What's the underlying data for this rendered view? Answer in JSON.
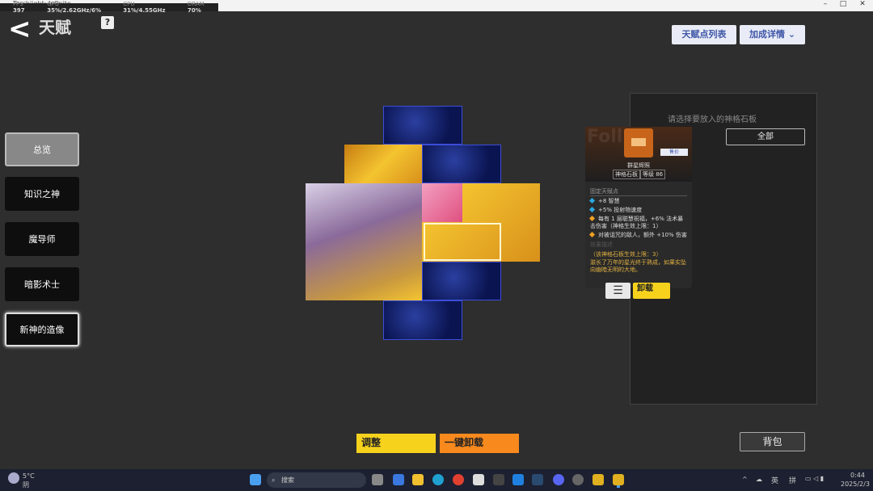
{
  "window": {
    "title": "Torchlight: Infinite",
    "perf": {
      "fps_label": "FPS",
      "fps": "397",
      "gpu_label": "GPU",
      "gpu": "35%/2.62GHz/6%",
      "cpu_label": "CPU",
      "cpu": "31%/4.55GHz",
      "dram_label": "DRAM",
      "dram": "70%"
    }
  },
  "header": {
    "title": "天赋",
    "help": "?",
    "talent_list": "天赋点列表",
    "bonus_details": "加成详情"
  },
  "sidebar": [
    {
      "label": "总览"
    },
    {
      "label": "知识之神"
    },
    {
      "label": "魔导师"
    },
    {
      "label": "暗影术士"
    },
    {
      "label": "新神的造像"
    }
  ],
  "panel": {
    "hint": "请选择要放入的神格石板",
    "filter": "全部"
  },
  "card": {
    "fade_text": "Foll",
    "price_btn": "售价",
    "name": "群星辉照",
    "type": "神格石板",
    "level": "等级 86",
    "fixed_header": "固定天赋点",
    "stats": [
      {
        "text": "+8 智慧",
        "color": "#2aa8e0"
      },
      {
        "text": "+5% 投射物速度",
        "color": "#2aa8e0"
      },
      {
        "text": "每有 1 层聪慧祝福，+6% 法术暴击伤害（神格生效上限：1）",
        "color": "#f0a020"
      },
      {
        "text": "对被诅咒的敌人，额外 +10% 伤害",
        "color": "#f0a020"
      }
    ],
    "desc_header": "效果描述",
    "limit": "（该神格石板生效上限：3）",
    "lore": "滋长了万年的星光终于熟成，如果实坠向幽暗无明的大地。",
    "unload": "卸载"
  },
  "bottom": {
    "adjust": "调整",
    "unload_all": "一键卸载",
    "bag": "背包"
  },
  "taskbar": {
    "weather_temp": "5°C",
    "weather_desc": "阴",
    "search": "搜索",
    "ime1": "英",
    "ime2": "拼",
    "time": "0:44",
    "date": "2025/2/3"
  }
}
